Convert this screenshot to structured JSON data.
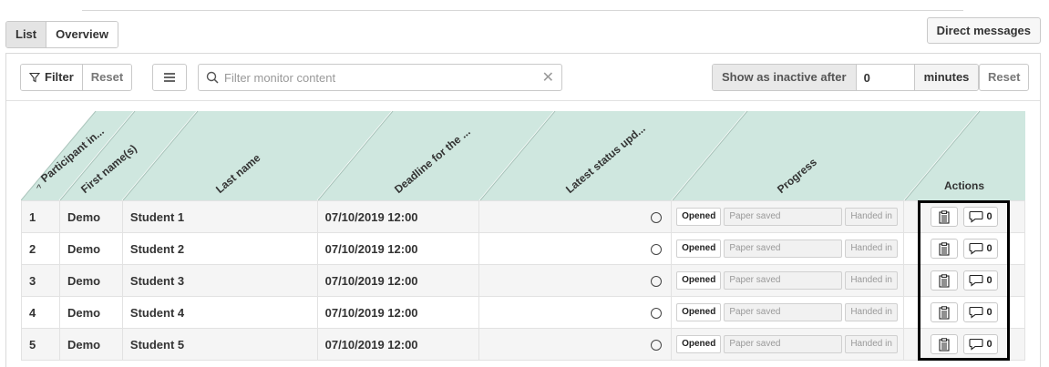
{
  "view_tabs": [
    {
      "label": "List",
      "active": true
    },
    {
      "label": "Overview",
      "active": false
    }
  ],
  "direct_messages_label": "Direct messages",
  "toolbar": {
    "filter_label": "Filter",
    "reset_label": "Reset",
    "search_placeholder": "Filter monitor content",
    "inactive_label": "Show as inactive after",
    "inactive_value": "0",
    "inactive_unit": "minutes",
    "reset2_label": "Reset"
  },
  "columns": [
    "Participant in...",
    "First name(s)",
    "Last name",
    "Deadline for the ...",
    "Latest status upd...",
    "Progress",
    "Actions"
  ],
  "progress_labels": {
    "opened": "Opened",
    "saved": "Paper saved",
    "handed": "Handed in"
  },
  "rows": [
    {
      "num": "1",
      "first": "Demo",
      "last": "Student 1",
      "deadline": "07/10/2019 12:00",
      "messages": "0"
    },
    {
      "num": "2",
      "first": "Demo",
      "last": "Student 2",
      "deadline": "07/10/2019 12:00",
      "messages": "0"
    },
    {
      "num": "3",
      "first": "Demo",
      "last": "Student 3",
      "deadline": "07/10/2019 12:00",
      "messages": "0"
    },
    {
      "num": "4",
      "first": "Demo",
      "last": "Student 4",
      "deadline": "07/10/2019 12:00",
      "messages": "0"
    },
    {
      "num": "5",
      "first": "Demo",
      "last": "Student 5",
      "deadline": "07/10/2019 12:00",
      "messages": "0"
    }
  ],
  "colors": {
    "header_bg": "#cfe7df",
    "highlight_border": "#000000"
  }
}
